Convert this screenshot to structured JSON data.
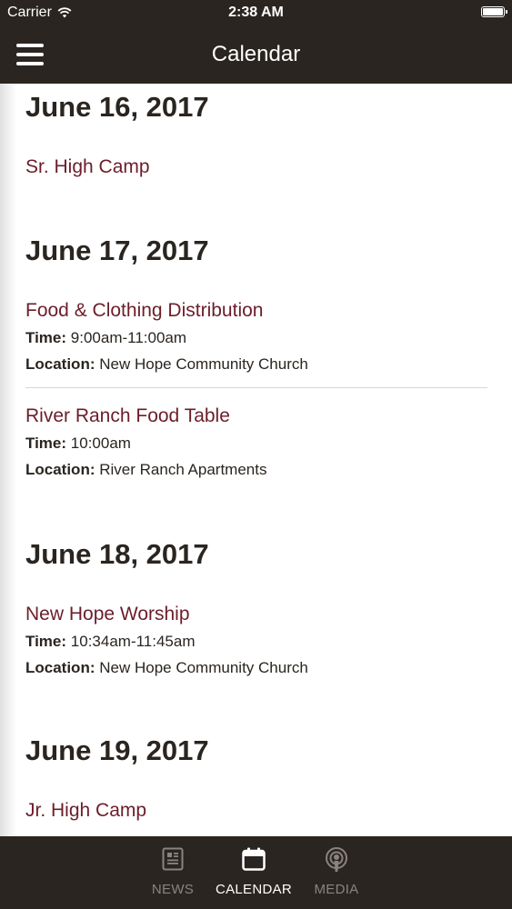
{
  "status_bar": {
    "carrier": "Carrier",
    "time": "2:38 AM"
  },
  "nav": {
    "title": "Calendar"
  },
  "days": [
    {
      "date": "June 16, 2017",
      "events": [
        {
          "title": "Sr. High Camp"
        }
      ]
    },
    {
      "date": "June 17, 2017",
      "events": [
        {
          "title": "Food & Clothing Distribution",
          "time_label": "Time:",
          "time": "9:00am-11:00am",
          "location_label": "Location:",
          "location": "New Hope Community Church"
        },
        {
          "title": "River Ranch Food Table",
          "time_label": "Time:",
          "time": "10:00am",
          "location_label": "Location:",
          "location": "River Ranch Apartments"
        }
      ]
    },
    {
      "date": "June 18, 2017",
      "events": [
        {
          "title": "New Hope Worship",
          "time_label": "Time:",
          "time": "10:34am-11:45am",
          "location_label": "Location:",
          "location": "New Hope Community Church"
        }
      ]
    },
    {
      "date": "June 19, 2017",
      "events": [
        {
          "title": "Jr. High Camp"
        }
      ]
    }
  ],
  "tabs": [
    {
      "label": "NEWS",
      "icon": "newspaper-icon"
    },
    {
      "label": "CALENDAR",
      "icon": "calendar-icon",
      "active": true
    },
    {
      "label": "MEDIA",
      "icon": "podcast-icon"
    }
  ],
  "colors": {
    "bar_background": "#2a2520",
    "event_title": "#6b1e2a",
    "heading_text": "#2a2520",
    "tab_inactive": "#8a847e",
    "tab_active": "#ffffff"
  }
}
